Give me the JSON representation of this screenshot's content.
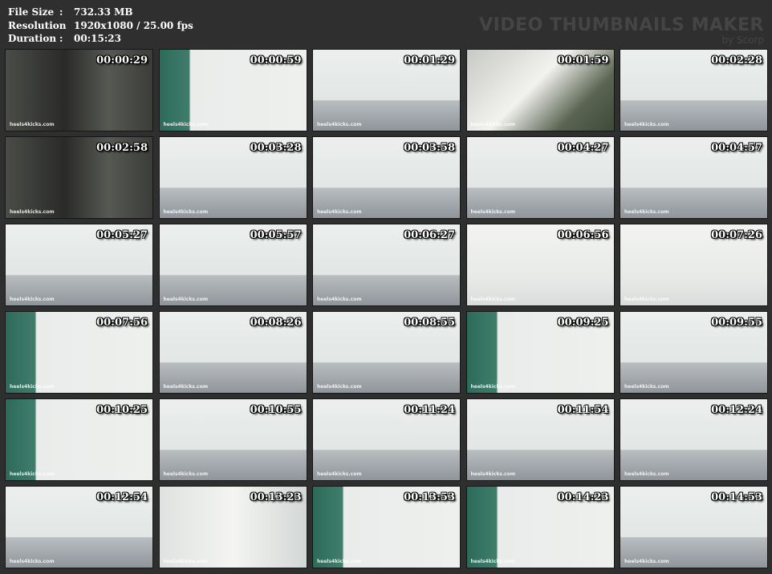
{
  "info": {
    "rows": [
      {
        "label": "File Size",
        "sep": ":",
        "value": "732.33 MB"
      },
      {
        "label": "Resolution",
        "sep": ":",
        "value": "1920x1080 / 25.00 fps"
      },
      {
        "label": "Duration",
        "sep": ":",
        "value": "00:15:23"
      }
    ]
  },
  "brand": {
    "name": "VIDEO THUMBNAILS MAKER",
    "by": "by Scorp"
  },
  "watermark": "heels4kicks.com",
  "thumbs": [
    {
      "time": "00:00:29",
      "scene": "dark"
    },
    {
      "time": "00:00:59",
      "scene": "teal"
    },
    {
      "time": "00:01:29",
      "scene": "room"
    },
    {
      "time": "00:01:59",
      "scene": "blur"
    },
    {
      "time": "00:02:28",
      "scene": "room"
    },
    {
      "time": "00:02:58",
      "scene": "dark"
    },
    {
      "time": "00:03:28",
      "scene": "room"
    },
    {
      "time": "00:03:58",
      "scene": "room"
    },
    {
      "time": "00:04:27",
      "scene": "room"
    },
    {
      "time": "00:04:57",
      "scene": "room"
    },
    {
      "time": "00:05:27",
      "scene": "room"
    },
    {
      "time": "00:05:57",
      "scene": "room"
    },
    {
      "time": "00:06:27",
      "scene": "room"
    },
    {
      "time": "00:06:56",
      "scene": "close"
    },
    {
      "time": "00:07:26",
      "scene": "close"
    },
    {
      "time": "00:07:56",
      "scene": "teal"
    },
    {
      "time": "00:08:26",
      "scene": "room"
    },
    {
      "time": "00:08:55",
      "scene": "room"
    },
    {
      "time": "00:09:25",
      "scene": "teal"
    },
    {
      "time": "00:09:55",
      "scene": "room"
    },
    {
      "time": "00:10:25",
      "scene": "teal"
    },
    {
      "time": "00:10:55",
      "scene": "room"
    },
    {
      "time": "00:11:24",
      "scene": "room"
    },
    {
      "time": "00:11:54",
      "scene": "room"
    },
    {
      "time": "00:12:24",
      "scene": "room"
    },
    {
      "time": "00:12:54",
      "scene": "room"
    },
    {
      "time": "00:13:23",
      "scene": "corner"
    },
    {
      "time": "00:13:53",
      "scene": "teal"
    },
    {
      "time": "00:14:23",
      "scene": "teal"
    },
    {
      "time": "00:14:53",
      "scene": "room"
    }
  ]
}
